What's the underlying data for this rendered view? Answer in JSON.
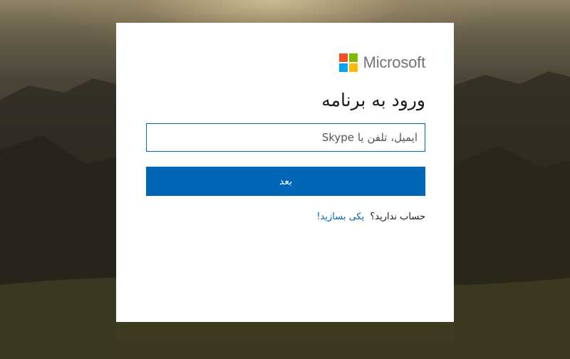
{
  "brand": {
    "name": "Microsoft",
    "logo_colors": [
      "#f25022",
      "#7fba00",
      "#00a4ef",
      "#ffb900"
    ]
  },
  "signin": {
    "title": "ورود به برنامه",
    "input_placeholder": "ایمیل، تلفن یا Skype",
    "input_value": "",
    "next_label": "بعد",
    "no_account_text": "حساب ندارید؟",
    "create_link_label": "یکی بسازید!"
  },
  "colors": {
    "accent": "#0067b8",
    "card_background": "#ffffff",
    "brand_text": "#737373"
  }
}
